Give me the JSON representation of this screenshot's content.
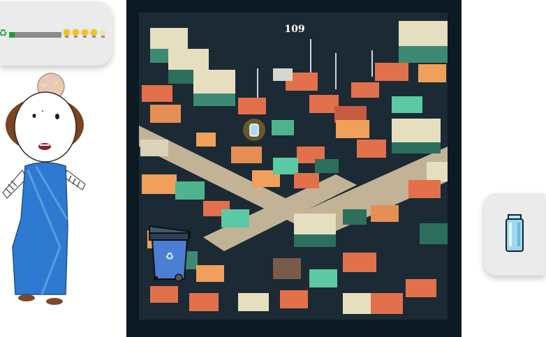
{
  "hud": {
    "progress": 0.1,
    "lightbulbs_total": 5,
    "lightbulbs_lit": 4,
    "recycle_icon": "recycle-icon",
    "bulb_icon": "lightbulb-icon",
    "bar_color": "#1f9e2f"
  },
  "game": {
    "score": "109",
    "bin_icon": "recycling-bin-icon",
    "item_icon": "glass-jar-icon"
  },
  "held_item": {
    "icon": "glass-jar-icon"
  }
}
